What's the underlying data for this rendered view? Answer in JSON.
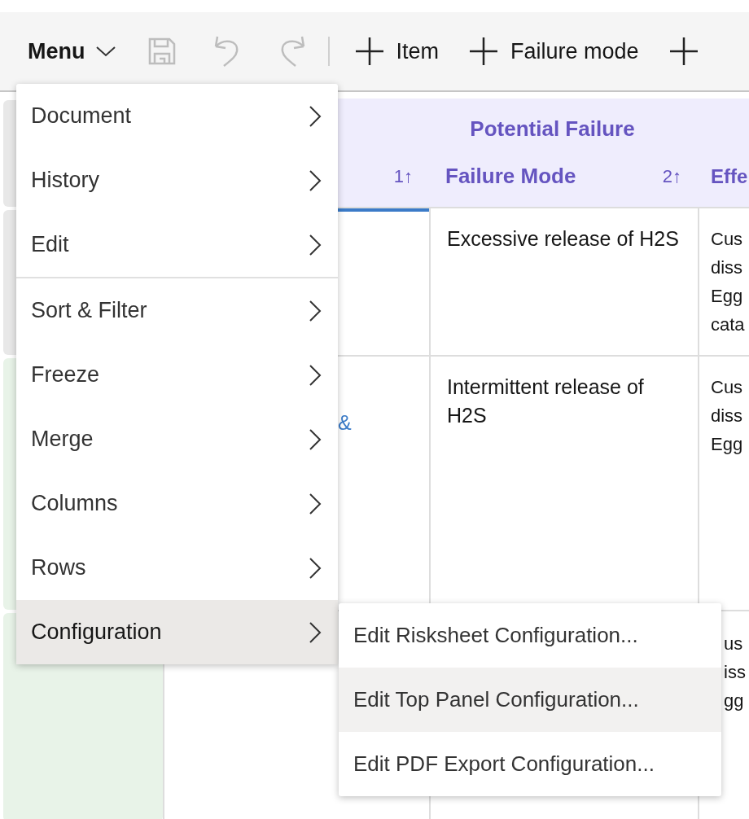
{
  "toolbar": {
    "menu_label": "Menu",
    "actions": [
      {
        "kind": "save",
        "disabled": true
      },
      {
        "kind": "undo",
        "disabled": true
      },
      {
        "kind": "redo",
        "disabled": true
      }
    ],
    "add_buttons": [
      {
        "label": "Item"
      },
      {
        "label": "Failure mode"
      }
    ]
  },
  "table": {
    "group_header": "Potential Failure",
    "columns": [
      {
        "sort": "1↑"
      },
      {
        "label": "Failure Mode",
        "sort": "2↑"
      },
      {
        "label": "Effe"
      }
    ],
    "rows": [
      {
        "color": "#e8e8e8",
        "link_cell": {
          "focused": true
        },
        "failure_mode": "Excessive release of H2S",
        "effects": [
          "Cus",
          "diss",
          "Egg",
          "cata"
        ]
      },
      {
        "color": "#e8f3e8",
        "link_cell": {
          "text": "&",
          "focused": false
        },
        "failure_mode": "Intermittent release of H2S",
        "effects": [
          "Cus",
          "diss",
          "Egg"
        ]
      },
      {
        "color": "#e8f3e8",
        "link_cell": {
          "focused": false
        },
        "effects": [
          "us",
          "iss",
          "gg"
        ]
      }
    ]
  },
  "menu": {
    "groups": [
      [
        {
          "label": "Document",
          "selected": false
        },
        {
          "label": "History",
          "selected": false
        },
        {
          "label": "Edit",
          "selected": false
        }
      ],
      [
        {
          "label": "Sort & Filter",
          "selected": false
        },
        {
          "label": "Freeze",
          "selected": false
        },
        {
          "label": "Merge",
          "selected": false
        },
        {
          "label": "Columns",
          "selected": false
        },
        {
          "label": "Rows",
          "selected": false
        },
        {
          "label": "Configuration",
          "selected": true
        }
      ]
    ],
    "submenu": [
      {
        "label": "Edit Risksheet Configuration...",
        "selected": false
      },
      {
        "label": "Edit Top Panel Configuration...",
        "selected": true
      },
      {
        "label": "Edit PDF Export Configuration...",
        "selected": false
      }
    ]
  }
}
